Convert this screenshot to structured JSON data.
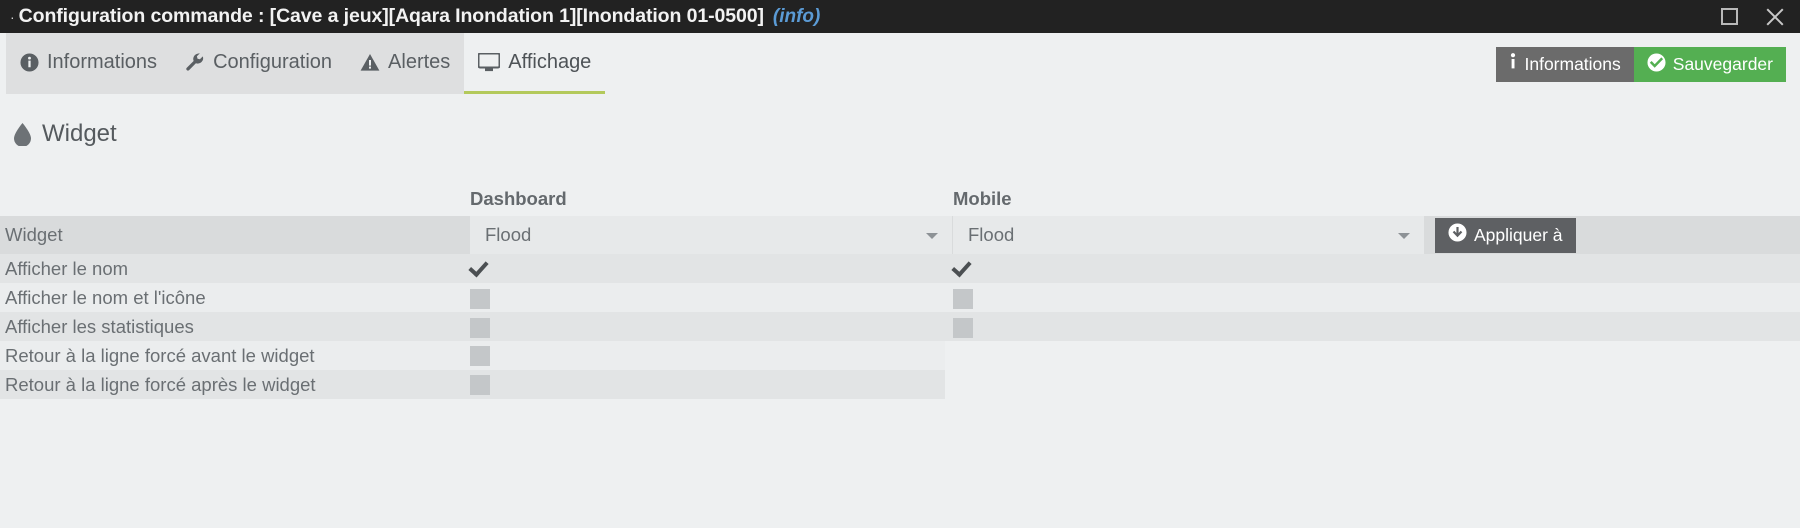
{
  "window": {
    "title": "Configuration commande : [Cave a jeux][Aqara Inondation 1][Inondation 01-0500]",
    "info_link": "(info)",
    "maximize_icon": "maximize-icon",
    "close_icon": "close-icon"
  },
  "tabs": [
    {
      "label": "Informations",
      "icon": "info-circle-icon",
      "active": false
    },
    {
      "label": "Configuration",
      "icon": "wrench-icon",
      "active": false
    },
    {
      "label": "Alertes",
      "icon": "warning-triangle-icon",
      "active": false
    },
    {
      "label": "Affichage",
      "icon": "monitor-icon",
      "active": true
    }
  ],
  "toolbar": {
    "informations_label": "Informations",
    "informations_icon": "info-icon",
    "sauvegarder_label": "Sauvegarder",
    "sauvegarder_icon": "check-circle-icon",
    "informations_color": "#6b6b6b",
    "sauvegarder_color": "#54af52"
  },
  "panel": {
    "title": "Widget",
    "icon": "water-drop-icon"
  },
  "table": {
    "columns": {
      "dashboard": "Dashboard",
      "mobile": "Mobile"
    },
    "widget_row": {
      "label": "Widget",
      "dashboard_value": "Flood",
      "mobile_value": "Flood",
      "apply_label": "Appliquer à",
      "apply_icon": "arrow-down-circle-icon"
    },
    "rows": [
      {
        "label": "Afficher le nom",
        "dashboard": "checked",
        "mobile": "checked",
        "has_mobile": true
      },
      {
        "label": "Afficher le nom et l'icône",
        "dashboard": "unchecked",
        "mobile": "unchecked",
        "has_mobile": true
      },
      {
        "label": "Afficher les statistiques",
        "dashboard": "unchecked",
        "mobile": "unchecked",
        "has_mobile": true
      },
      {
        "label": "Retour à la ligne forcé avant le widget",
        "dashboard": "unchecked",
        "mobile": "",
        "has_mobile": false
      },
      {
        "label": "Retour à la ligne forcé après le widget",
        "dashboard": "unchecked",
        "mobile": "",
        "has_mobile": false
      }
    ]
  },
  "colors": {
    "titlebar": "#222222",
    "page_bg": "#eef0f1",
    "active_tab_underline": "#b3c95b",
    "row_dark": "#e2e4e5",
    "row_light": "#ebedee"
  }
}
